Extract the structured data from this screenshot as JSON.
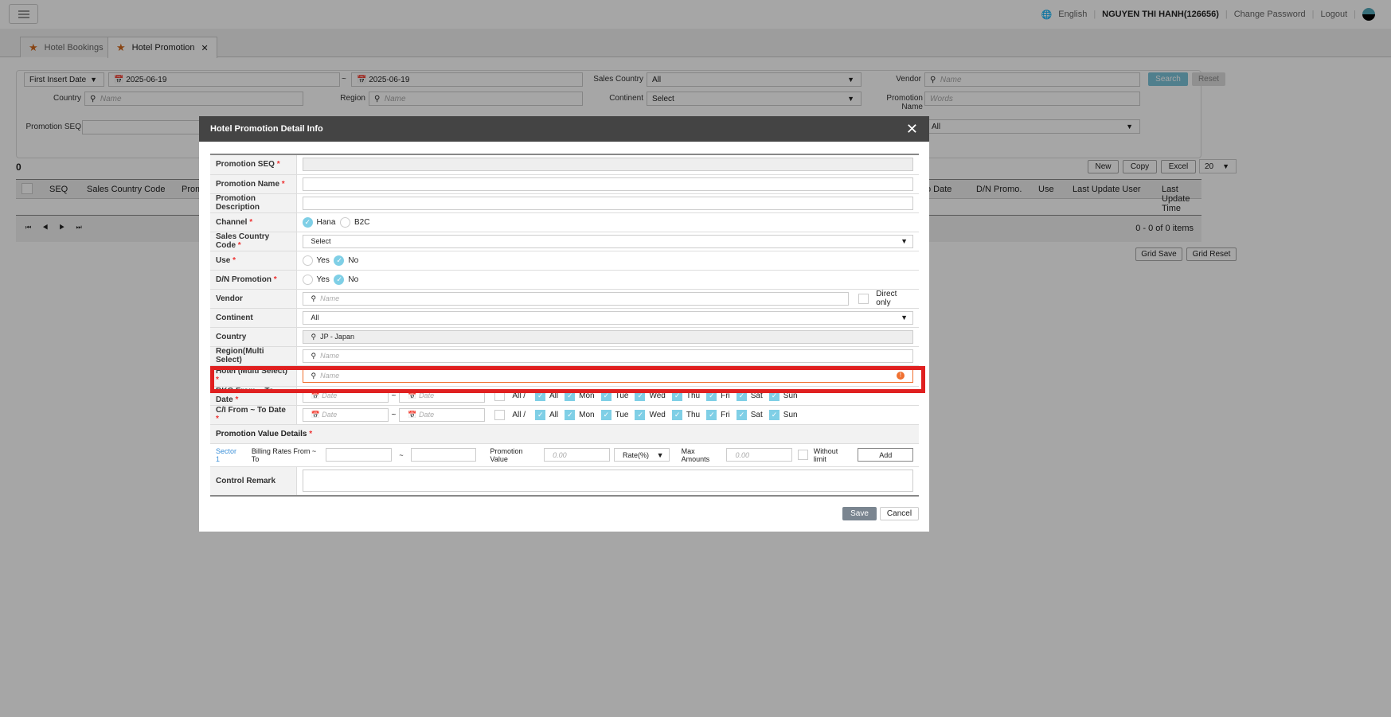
{
  "header": {
    "language": "English",
    "user": "NGUYEN THI HANH(126656)",
    "change_password": "Change Password",
    "logout": "Logout"
  },
  "tabs": [
    {
      "label": "Hotel Bookings"
    },
    {
      "label": "Hotel Promotion"
    }
  ],
  "filter": {
    "date_type": "First Insert Date",
    "date_from": "2025-06-19",
    "date_to": "2025-06-19",
    "tilde": "~",
    "sales_country_label": "Sales Country",
    "sales_country": "All",
    "vendor_label": "Vendor",
    "name_ph": "Name",
    "country_label": "Country",
    "region_label": "Region",
    "continent_label": "Continent",
    "continent": "Select",
    "promotion_name_label": "Promotion Name",
    "words_ph": "Words",
    "promotion_seq_label": "Promotion SEQ",
    "use": "All",
    "search": "Search",
    "reset": "Reset"
  },
  "grid": {
    "count": "0",
    "new": "New",
    "copy": "Copy",
    "excel": "Excel",
    "page_size": "20",
    "columns": [
      "SEQ",
      "Sales Country Code",
      "Prom",
      "o Date",
      "D/N Promo.",
      "Use",
      "Last Update User",
      "Last Update Time"
    ],
    "items": "0 - 0 of 0 items",
    "grid_save": "Grid Save",
    "grid_reset": "Grid Reset"
  },
  "modal": {
    "title": "Hotel Promotion Detail Info",
    "labels": {
      "seq": "Promotion SEQ",
      "name": "Promotion Name",
      "desc": "Promotion Description",
      "channel": "Channel",
      "sales_country": "Sales Country Code",
      "use": "Use",
      "dn": "D/N Promotion",
      "vendor": "Vendor",
      "continent": "Continent",
      "country": "Country",
      "region": "Region(Multi Select)",
      "hotel": "Hotel (Multi Select)",
      "bkg": "BKG From ~ To Date",
      "ci": "C/I From ~ To Date",
      "pvd": "Promotion Value Details",
      "remark": "Control Remark"
    },
    "req": "*",
    "hana": "Hana",
    "b2c": "B2C",
    "select": "Select",
    "yes": "Yes",
    "no": "No",
    "direct_only": "Direct only",
    "all": "All",
    "country_value": "JP - Japan",
    "name_ph": "Name",
    "date_ph": "Date",
    "dash": "~",
    "all_slash": "All /",
    "days": [
      "All",
      "Mon",
      "Tue",
      "Wed",
      "Thu",
      "Fri",
      "Sat",
      "Sun"
    ],
    "sector": "Sector 1",
    "billing": "Billing Rates From ~ To",
    "promo_value": "Promotion Value",
    "amount_ph": "0.00",
    "rate": "Rate(%)",
    "max_amounts": "Max Amounts",
    "without_limit": "Without limit",
    "add": "Add",
    "save": "Save",
    "cancel": "Cancel"
  }
}
